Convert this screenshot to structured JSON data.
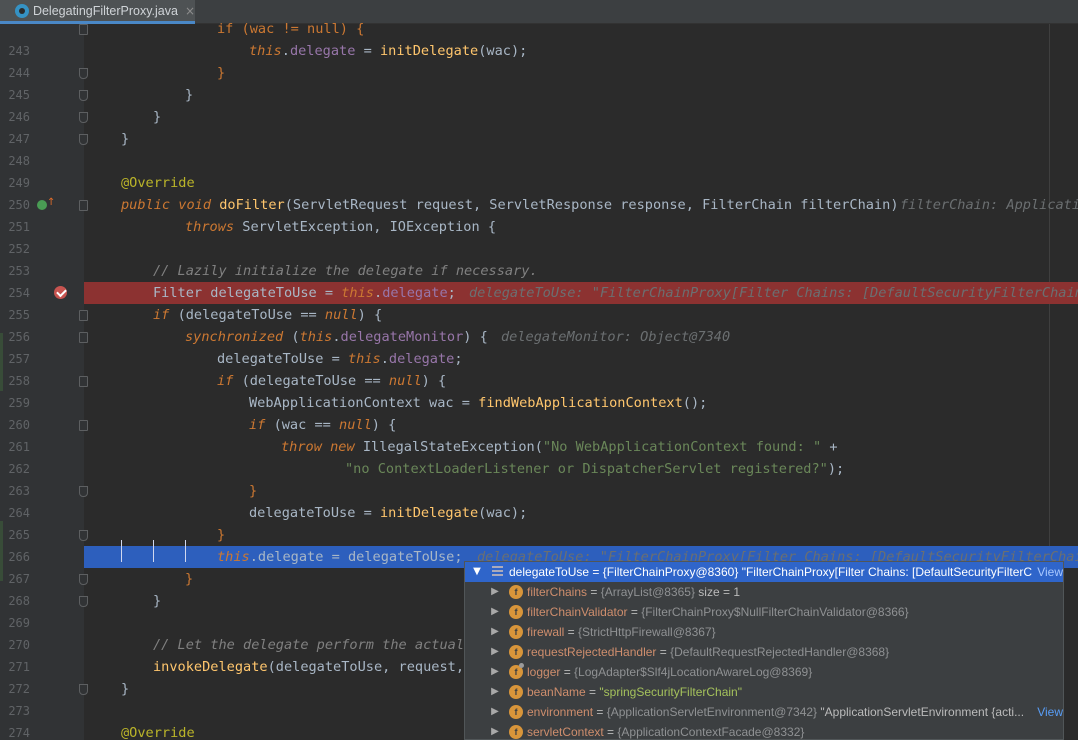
{
  "tab": {
    "file_name": "DelegatingFilterProxy.java",
    "close_glyph": "×",
    "icon": "java-class-icon"
  },
  "code": {
    "first_line_number": 242,
    "lines": [
      {
        "n": "",
        "code": [
          [
            "if (wac != null) {",
            "kwn"
          ]
        ]
      },
      {
        "n": "243",
        "code": [
          [
            "this",
            "kw"
          ],
          [
            ".",
            ""
          ],
          [
            "delegate",
            "fld"
          ],
          [
            " = ",
            ""
          ],
          [
            "initDelegate",
            "fn"
          ],
          [
            "(wac);",
            ""
          ]
        ]
      },
      {
        "n": "244",
        "code": [
          [
            "}",
            "kwn"
          ]
        ]
      },
      {
        "n": "245",
        "code": [
          [
            "}",
            ""
          ]
        ]
      },
      {
        "n": "246",
        "code": [
          [
            "}",
            ""
          ]
        ]
      },
      {
        "n": "247",
        "code": [
          [
            "}",
            ""
          ]
        ]
      },
      {
        "n": "248",
        "code": []
      },
      {
        "n": "249",
        "code": [
          [
            "@Override",
            "ann"
          ]
        ]
      },
      {
        "n": "250",
        "code": [
          [
            "public ",
            "kw"
          ],
          [
            "void ",
            "kw"
          ],
          [
            "doFilter",
            "fn"
          ],
          [
            "(ServletRequest request, ServletResponse response, FilterChain filterChain)",
            ""
          ]
        ]
      },
      {
        "n": "251",
        "code": [
          [
            "throws ",
            "kw"
          ],
          [
            "ServletException, IOException {",
            ""
          ]
        ]
      },
      {
        "n": "252",
        "code": []
      },
      {
        "n": "253",
        "code": [
          [
            "// Lazily initialize the delegate if necessary.",
            "cm"
          ]
        ]
      },
      {
        "n": "254",
        "code": [
          [
            "Filter delegateToUse = ",
            ""
          ],
          [
            "this",
            "kw"
          ],
          [
            ".",
            ""
          ],
          [
            "delegate",
            "fld"
          ],
          [
            ";",
            ""
          ]
        ]
      },
      {
        "n": "255",
        "code": [
          [
            "if ",
            "kw"
          ],
          [
            "(delegateToUse == ",
            ""
          ],
          [
            "null",
            "kw"
          ],
          [
            ") {",
            ""
          ]
        ]
      },
      {
        "n": "256",
        "code": [
          [
            "synchronized ",
            "kw"
          ],
          [
            "(",
            ""
          ],
          [
            "this",
            "kw"
          ],
          [
            ".",
            ""
          ],
          [
            "delegateMonitor",
            "fld"
          ],
          [
            ") {",
            ""
          ]
        ]
      },
      {
        "n": "257",
        "code": [
          [
            "delegateToUse = ",
            ""
          ],
          [
            "this",
            "kw"
          ],
          [
            ".",
            ""
          ],
          [
            "delegate",
            "fld"
          ],
          [
            ";",
            ""
          ]
        ]
      },
      {
        "n": "258",
        "code": [
          [
            "if ",
            "kw"
          ],
          [
            "(delegateToUse == ",
            ""
          ],
          [
            "null",
            "kw"
          ],
          [
            ") {",
            ""
          ]
        ]
      },
      {
        "n": "259",
        "code": [
          [
            "WebApplicationContext wac = ",
            ""
          ],
          [
            "findWebApplicationContext",
            "fn"
          ],
          [
            "();",
            ""
          ]
        ]
      },
      {
        "n": "260",
        "code": [
          [
            "if ",
            "kw"
          ],
          [
            "(wac == ",
            ""
          ],
          [
            "null",
            "kw"
          ],
          [
            ") {",
            ""
          ]
        ]
      },
      {
        "n": "261",
        "code": [
          [
            "throw new ",
            "kw"
          ],
          [
            "IllegalStateException(",
            ""
          ],
          [
            "\"No WebApplicationContext found: \"",
            "str"
          ],
          [
            " +",
            ""
          ]
        ]
      },
      {
        "n": "262",
        "code": [
          [
            "\"no ContextLoaderListener or DispatcherServlet registered?\"",
            "str"
          ],
          [
            ");",
            ""
          ]
        ]
      },
      {
        "n": "263",
        "code": [
          [
            "}",
            "kwn"
          ]
        ]
      },
      {
        "n": "264",
        "code": [
          [
            "delegateToUse = ",
            ""
          ],
          [
            "initDelegate",
            "fn"
          ],
          [
            "(wac);",
            ""
          ]
        ]
      },
      {
        "n": "265",
        "code": [
          [
            "}",
            "kwn"
          ]
        ]
      },
      {
        "n": "266",
        "code": [
          [
            "this",
            "kw"
          ],
          [
            ".delegate = delegateToUse;",
            ""
          ]
        ]
      },
      {
        "n": "267",
        "code": [
          [
            "}",
            "kwn"
          ]
        ]
      },
      {
        "n": "268",
        "code": [
          [
            "}",
            ""
          ]
        ]
      },
      {
        "n": "269",
        "code": []
      },
      {
        "n": "270",
        "code": [
          [
            "// Let the delegate perform the actual ",
            "cm"
          ]
        ]
      },
      {
        "n": "271",
        "code": [
          [
            "invokeDelegate",
            "fn"
          ],
          [
            "(delegateToUse, request, ",
            ""
          ]
        ]
      },
      {
        "n": "272",
        "code": [
          [
            "}",
            ""
          ]
        ]
      },
      {
        "n": "273",
        "code": []
      },
      {
        "n": "274",
        "code": [
          [
            "@Override",
            "ann"
          ]
        ]
      }
    ],
    "hints": {
      "250": "filterChain: Applicati",
      "254": "delegateToUse: \"FilterChainProxy[Filter Chains: [DefaultSecurityFilterChain ",
      "256": "delegateMonitor: Object@7340",
      "266": "delegateToUse: \"FilterChainProxy[Filter Chains: [DefaultSecurityFilterChain"
    }
  },
  "debugger": {
    "root": {
      "name": "delegateToUse",
      "value": "{FilterChainProxy@8360}",
      "string": "\"FilterChainProxy[Filter Chains: [DefaultSecurityFilterC...",
      "link": "View"
    },
    "fields": [
      {
        "name": "filterChains",
        "value": "{ArrayList@8365}",
        "extra": "size = 1",
        "icon": "field-icon"
      },
      {
        "name": "filterChainValidator",
        "value": "{FilterChainProxy$NullFilterChainValidator@8366}",
        "extra": "",
        "icon": "field-icon"
      },
      {
        "name": "firewall",
        "value": "{StrictHttpFirewall@8367}",
        "extra": "",
        "icon": "field-icon"
      },
      {
        "name": "requestRejectedHandler",
        "value": "{DefaultRequestRejectedHandler@8368}",
        "extra": "",
        "icon": "field-icon"
      },
      {
        "name": "logger",
        "value": "{LogAdapter$Slf4jLocationAwareLog@8369}",
        "extra": "",
        "icon": "static-field-icon"
      },
      {
        "name": "beanName",
        "value": "\"springSecurityFilterChain\"",
        "extra": "",
        "icon": "field-icon",
        "is_string": true
      },
      {
        "name": "environment",
        "value": "{ApplicationServletEnvironment@7342}",
        "extra": "\"ApplicationServletEnvironment {acti...",
        "icon": "field-icon",
        "link": "View"
      },
      {
        "name": "servletContext",
        "value": "{ApplicationContextFacade@8332}",
        "extra": "",
        "icon": "field-icon"
      }
    ]
  }
}
